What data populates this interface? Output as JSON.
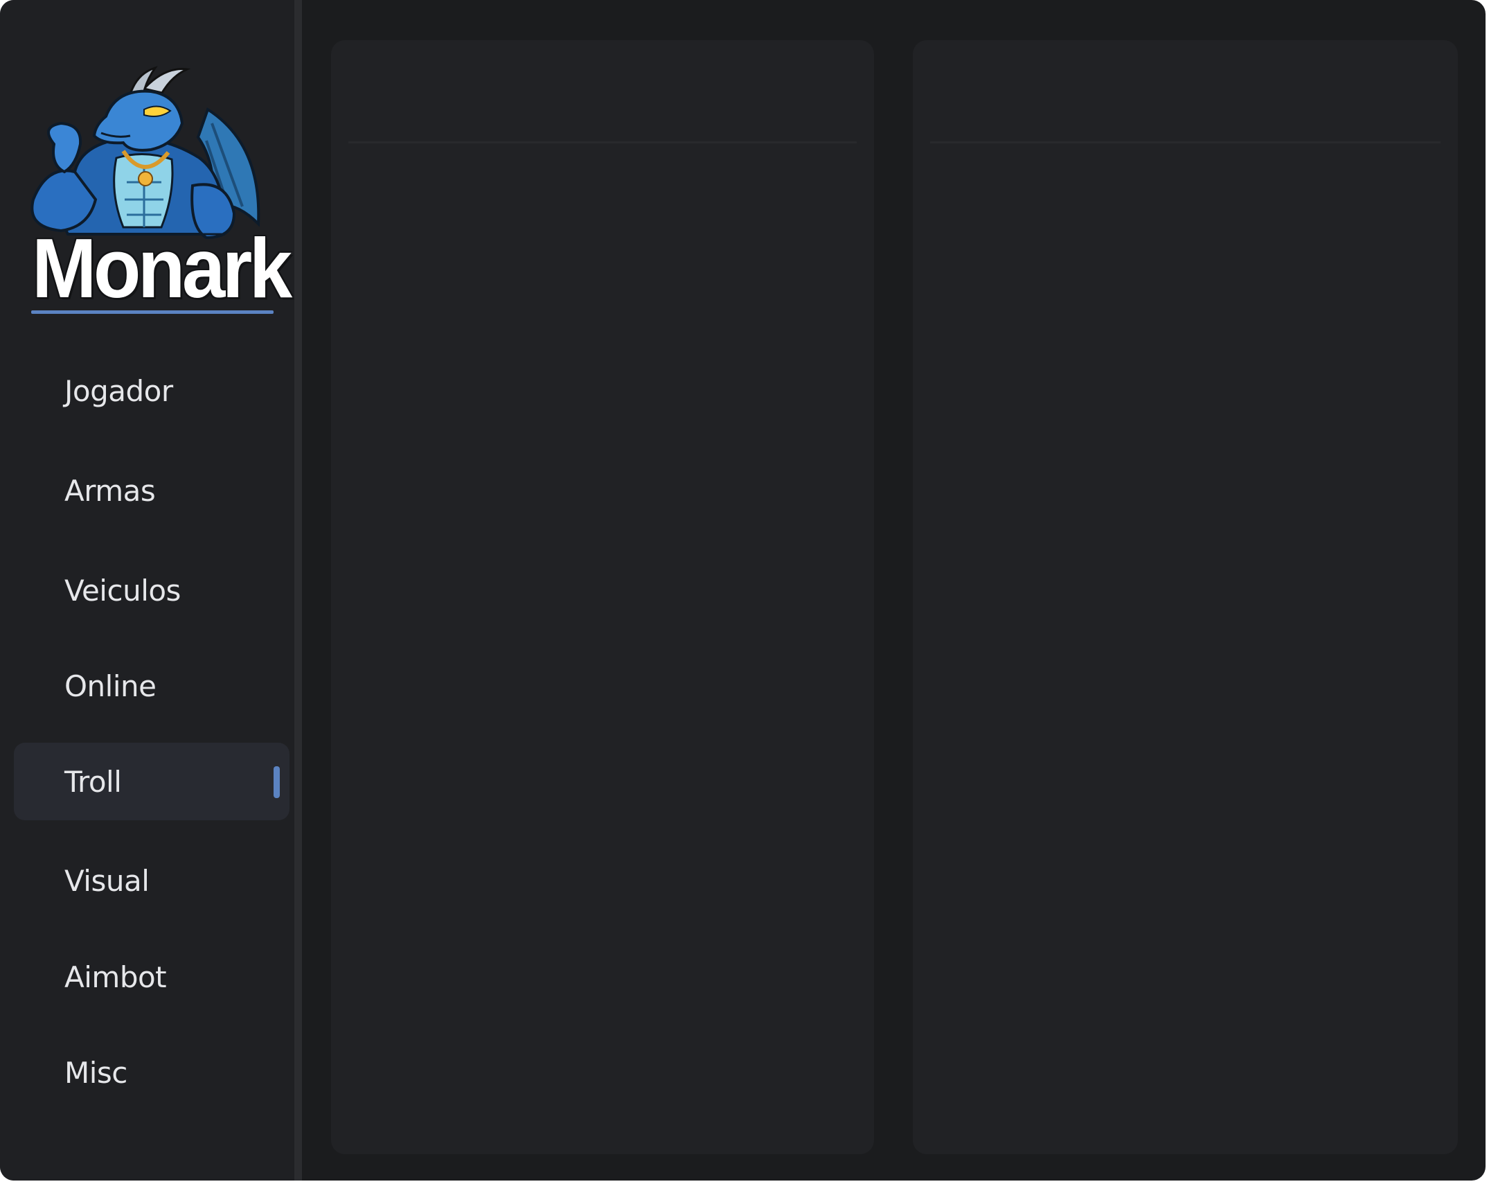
{
  "app": {
    "brand": "Monark"
  },
  "sidebar": {
    "items": [
      {
        "label": "Jogador",
        "active": false
      },
      {
        "label": "Armas",
        "active": false
      },
      {
        "label": "Veiculos",
        "active": false
      },
      {
        "label": "Online",
        "active": false
      },
      {
        "label": "Troll",
        "active": true
      },
      {
        "label": "Visual",
        "active": false
      },
      {
        "label": "Aimbot",
        "active": false
      },
      {
        "label": "Misc",
        "active": false
      }
    ]
  },
  "panels": {
    "left": {
      "title": ""
    },
    "right": {
      "title": ""
    }
  },
  "colors": {
    "window_bg": "#1b1c1e",
    "sidebar_bg": "#1f2023",
    "panel_bg": "#212225",
    "accent": "#5b83c2",
    "active_item_bg": "#282a31",
    "text": "#e6e7ea"
  },
  "icons": {
    "logo": "blue-dragon-mascot-icon"
  }
}
